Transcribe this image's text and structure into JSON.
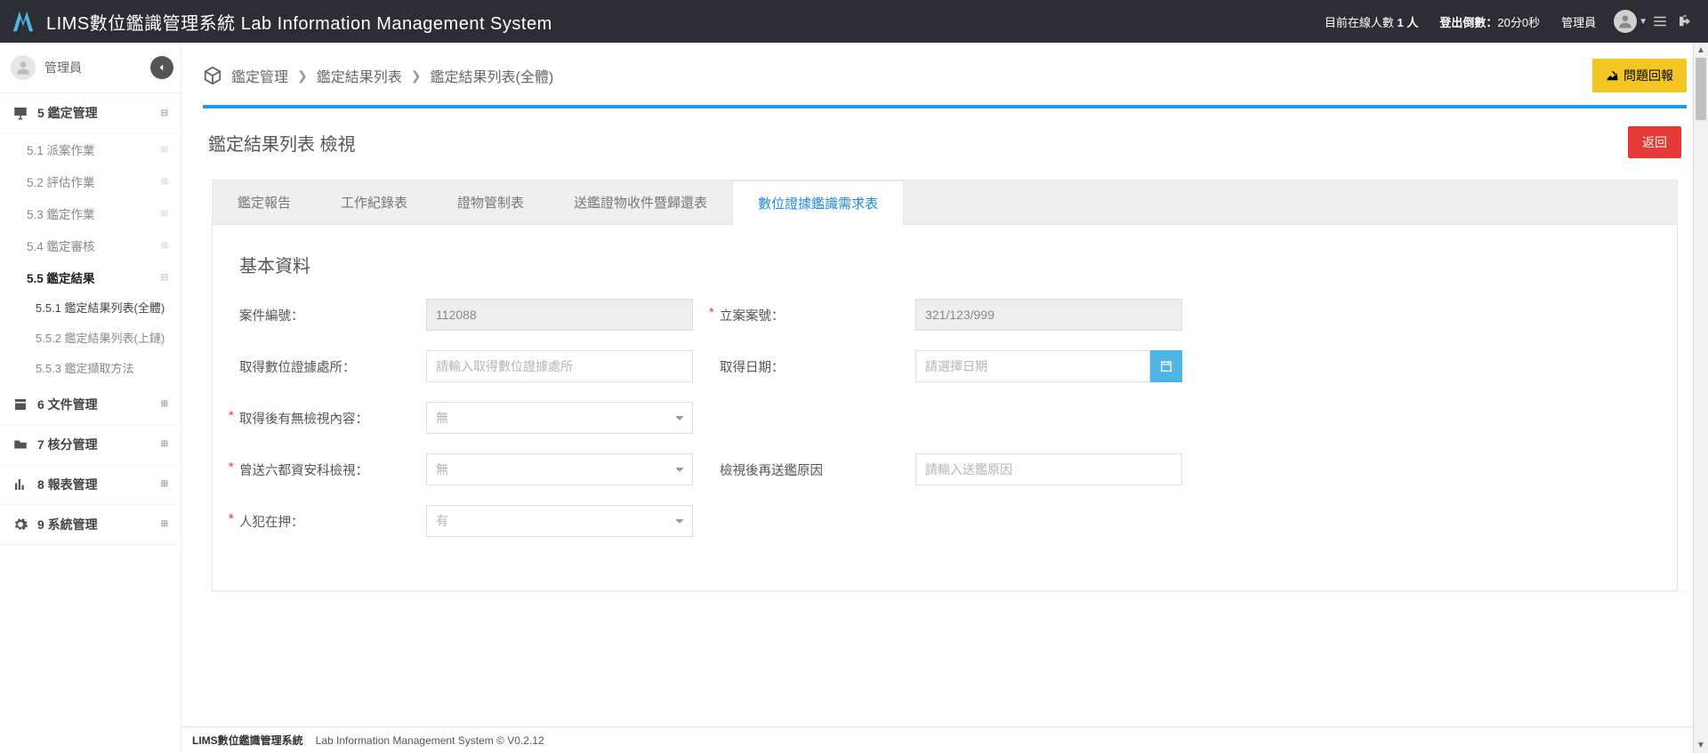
{
  "topbar": {
    "title": "LIMS數位鑑識管理系統 Lab Information Management System",
    "online_label": "目前在線人數 ",
    "online_count": "1 人",
    "logout_label": "登出倒數：",
    "logout_time": "20分0秒",
    "role": "管理員"
  },
  "sidebar": {
    "username": "管理員",
    "section5": {
      "label": "5 鑑定管理"
    },
    "items": [
      {
        "label": "5.1 派案作業"
      },
      {
        "label": "5.2 評估作業"
      },
      {
        "label": "5.3 鑑定作業"
      },
      {
        "label": "5.4 鑑定審核"
      },
      {
        "label": "5.5 鑑定結果"
      }
    ],
    "subs": [
      {
        "label": "5.5.1 鑑定結果列表(全體)"
      },
      {
        "label": "5.5.2 鑑定結果列表(上鏈)"
      },
      {
        "label": "5.5.3 鑑定擷取方法"
      }
    ],
    "section6": {
      "label": "6 文件管理"
    },
    "section7": {
      "label": "7 核分管理"
    },
    "section8": {
      "label": "8 報表管理"
    },
    "section9": {
      "label": "9 系統管理"
    }
  },
  "breadcrumb": {
    "a": "鑑定管理",
    "b": "鑑定結果列表",
    "c": "鑑定結果列表(全體)"
  },
  "buttons": {
    "issue": "問題回報",
    "back": "返回"
  },
  "panel": {
    "title": "鑑定結果列表 檢視"
  },
  "tabs": {
    "t1": "鑑定報告",
    "t2": "工作紀錄表",
    "t3": "證物管制表",
    "t4": "送鑑證物收件暨歸還表",
    "t5": "數位證據鑑識需求表"
  },
  "form": {
    "section_title": "基本資料",
    "case_no_label": "案件編號：",
    "case_no_value": "112088",
    "filed_no_label": "立案案號：",
    "filed_no_value": "321/123/999",
    "evidence_place_label": "取得數位證據處所：",
    "evidence_place_ph": "請輸入取得數位證據處所",
    "obtain_date_label": "取得日期：",
    "obtain_date_ph": "請選擇日期",
    "viewed_label": "取得後有無檢視內容：",
    "viewed_value": "無",
    "sent6_label": "曾送六都資安科檢視：",
    "sent6_value": "無",
    "resend_label": "檢視後再送鑑原因",
    "resend_ph": "請輸入送鑑原因",
    "detained_label": "人犯在押：",
    "detained_value": "有"
  },
  "footer": {
    "brand": "LIMS數位鑑識管理系統",
    "version": "Lab Information Management System © V0.2.12"
  }
}
